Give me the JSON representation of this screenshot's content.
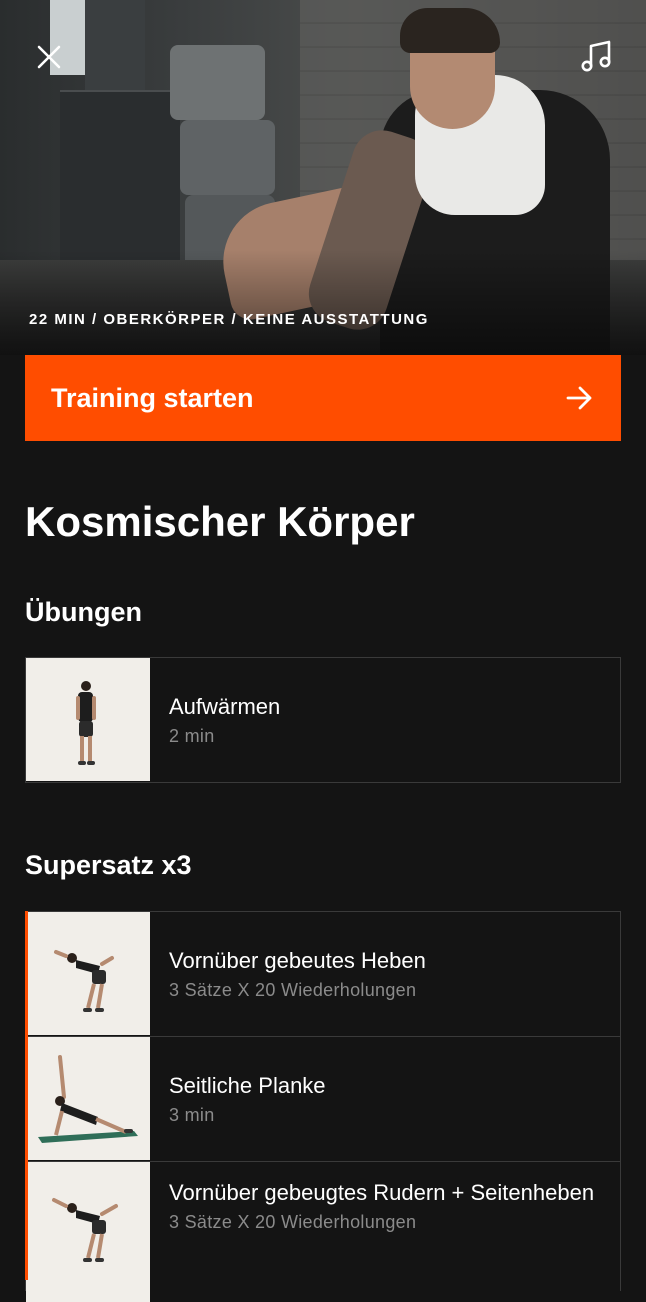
{
  "header": {
    "close_icon": "close-icon",
    "music_icon": "music-note-icon",
    "meta": "22 MIN / OBERKÖRPER / KEINE AUSSTATTUNG"
  },
  "cta": {
    "label": "Training starten",
    "icon": "arrow-right-icon"
  },
  "workout": {
    "title": "Kosmischer Körper"
  },
  "sections": [
    {
      "title": "Übungen",
      "items": [
        {
          "name": "Aufwärmen",
          "detail": "2 min"
        }
      ]
    },
    {
      "title": "Supersatz x3",
      "items": [
        {
          "name": "Vornüber gebeutes Heben",
          "detail": "3 Sätze X 20 Wiederholungen"
        },
        {
          "name": "Seitliche Planke",
          "detail": "3 min"
        },
        {
          "name": "Vornüber gebeugtes Rudern + Seitenheben",
          "detail": "3 Sätze X 20 Wiederholungen"
        }
      ]
    }
  ],
  "colors": {
    "accent": "#ff4d00",
    "background": "#141414",
    "muted": "#8b8b8b"
  }
}
